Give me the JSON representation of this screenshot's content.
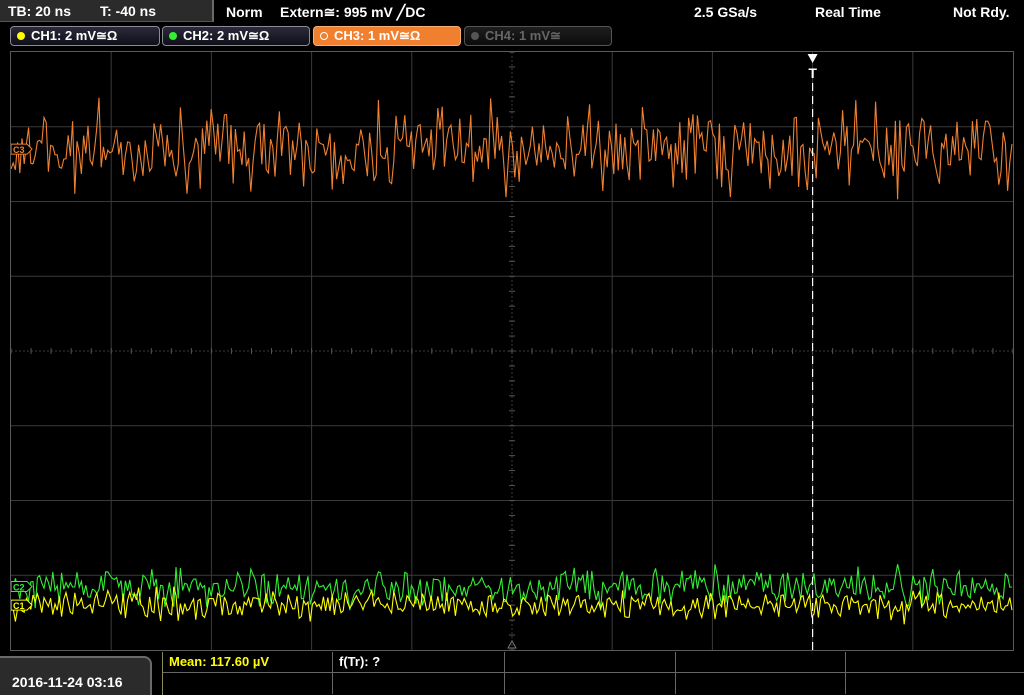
{
  "status_bar": {
    "timebase": "TB: 20 ns",
    "trigger_time": "T: -40 ns",
    "trigger_mode": "Norm",
    "trigger_source": "Extern≅: 995 mV ╱DC",
    "sample_rate": "2.5 GSa/s",
    "acquisition_mode": "Real Time",
    "state": "Not Rdy."
  },
  "channels": [
    {
      "label": "CH1: 2 mV≅Ω",
      "color": "#ffff00",
      "state": "on"
    },
    {
      "label": "CH2: 2 mV≅Ω",
      "color": "#33ee33",
      "state": "on"
    },
    {
      "label": "CH3: 1 mV≅Ω",
      "color": "#f08030",
      "state": "active"
    },
    {
      "label": "CH4: 1 mV≅",
      "color": "#555555",
      "state": "off"
    }
  ],
  "display": {
    "trigger_marker": "T",
    "channel_markers": [
      "C3",
      "C2",
      "C1"
    ],
    "grid": {
      "horizontal_divisions": 10,
      "vertical_divisions": 8,
      "grid_color": "#3a3a3a",
      "background": "#000000"
    }
  },
  "chart_data": {
    "type": "line",
    "title": "",
    "series": [
      {
        "name": "CH3",
        "color": "#f08030",
        "level_divisions": 6.7,
        "noise_divisions": 0.45
      },
      {
        "name": "CH2",
        "color": "#33ee33",
        "level_divisions": 0.85,
        "noise_divisions": 0.22
      },
      {
        "name": "CH1",
        "color": "#ffff00",
        "level_divisions": 0.6,
        "noise_divisions": 0.17
      }
    ],
    "trigger_position_divisions": 8,
    "grid": true
  },
  "footer": {
    "datetime": "2016-11-24 03:16",
    "measurements": [
      "Mean: 117.60 µV",
      "f(Tr): ?"
    ],
    "measure_color": "#ffff00"
  }
}
